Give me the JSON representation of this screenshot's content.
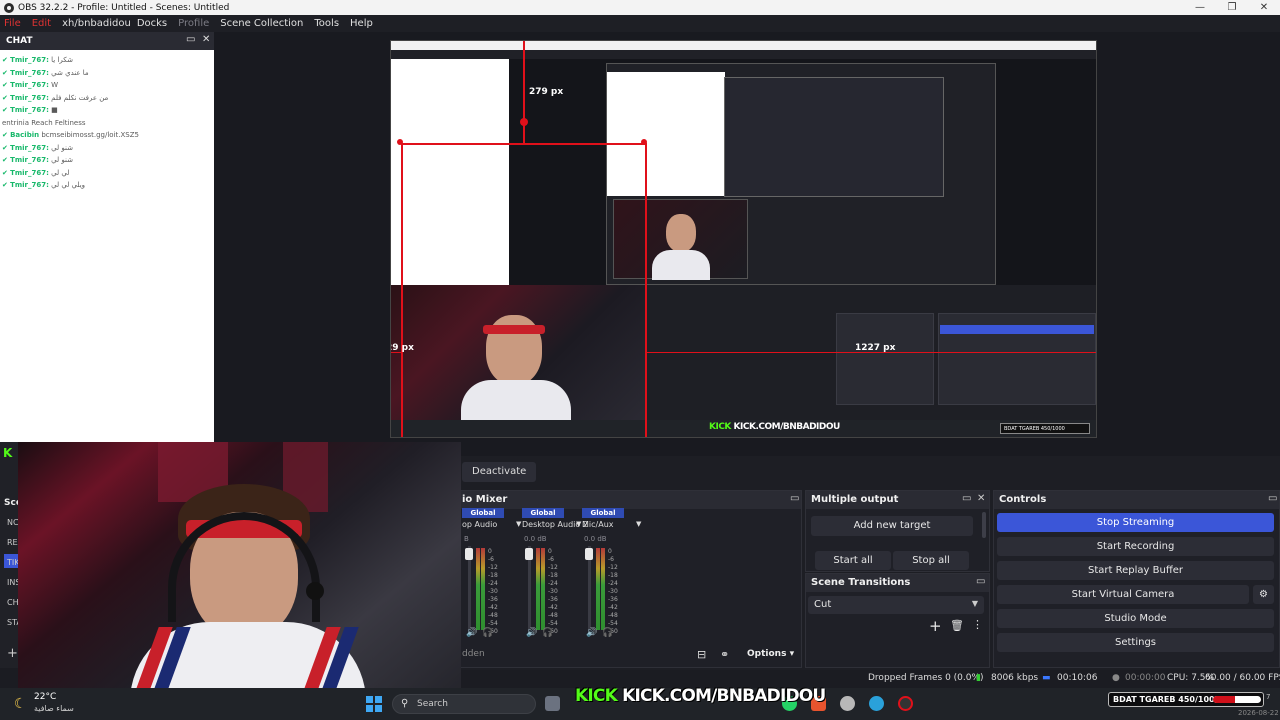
{
  "window": {
    "title": "OBS 32.2.2 - Profile: Untitled - Scenes: Untitled",
    "controls": [
      "—",
      "❐",
      "✕"
    ]
  },
  "menu": [
    "File",
    "Edit",
    "View",
    "Docks",
    "Profile",
    "Scene Collection",
    "Tools",
    "Help"
  ],
  "menu_overlay_text": "xh/bnbadidou",
  "chat": {
    "title": "CHAT",
    "lines": [
      {
        "user": "Tmir_767:",
        "msg": "شكرا يا"
      },
      {
        "user": "Tmir_767:",
        "msg": "ما عندي شي"
      },
      {
        "user": "Tmir_767:",
        "msg": "W"
      },
      {
        "user": "Tmir_767:",
        "msg": "من عرفت نكلم فلم"
      },
      {
        "user": "Tmir_767:",
        "msg": "■"
      },
      {
        "user": "",
        "msg": "entrinia Reach Feltiness"
      },
      {
        "user": "Bacibin",
        "msg": "bcmseibimosst.gg/loit.XSZ5"
      },
      {
        "user": "Tmir_767:",
        "msg": "شنو لي"
      },
      {
        "user": "Tmir_767:",
        "msg": "شنو لي"
      },
      {
        "user": "Tmir_767:",
        "msg": "لي لي"
      },
      {
        "user": "Tmir_767:",
        "msg": "ويلي لي لي"
      }
    ]
  },
  "preview": {
    "measure_top": "279 px",
    "measure_left": "29 px",
    "measure_right": "1227 px",
    "inner_kick": "KICK",
    "inner_kick_url": "KICK.COM/BNBADIDOU",
    "inner_goal": "BDAT TGAREB 450/1000",
    "inner_controls": [
      "Stop Streaming",
      "Start Recording",
      "Start Replay Buffer",
      "Start Virtual Camera",
      "Studio Mode",
      "Settings"
    ],
    "inner_stats": "Dropped Frames 0 (0.0%)   8006 kbps   00:10:06   00:00:00   CPU: 7.5%   60.00 / 60.00 FPS"
  },
  "transition_bar": {
    "filters": "lters",
    "deactivate": "Deactivate"
  },
  "scenes_strip": {
    "head": "Sce",
    "items": [
      "NC",
      "REA",
      "TIK",
      "INS",
      "CH",
      "STA"
    ],
    "add": "+"
  },
  "audio_mixer": {
    "title": "io Mixer",
    "channels": [
      {
        "tag": "Global",
        "name": "op Audio",
        "db": "B"
      },
      {
        "tag": "Global",
        "name": "Desktop Audio 2",
        "db": "0.0 dB"
      },
      {
        "tag": "Global",
        "name": "Mic/Aux",
        "db": "0.0 dB"
      }
    ],
    "scale": [
      "0",
      "-6",
      "-12",
      "-18",
      "-24",
      "-30",
      "-36",
      "-42",
      "-48",
      "-54",
      "-60"
    ],
    "hidden_label": "dden",
    "options": "Options"
  },
  "multiple_output": {
    "title": "Multiple output",
    "add_target": "Add new target",
    "start_all": "Start all",
    "stop_all": "Stop all"
  },
  "scene_transitions": {
    "title": "Scene Transitions",
    "value": "Cut"
  },
  "controls": {
    "title": "Controls",
    "buttons": [
      "Stop Streaming",
      "Start Recording",
      "Start Replay Buffer",
      "Start Virtual Camera",
      "Studio Mode",
      "Settings"
    ]
  },
  "status": {
    "dropped": "Dropped Frames 0 (0.0%)",
    "kbps": "8006 kbps",
    "stream_time": "00:10:06",
    "rec_time": "00:00:00",
    "cpu": "CPU: 7.5%",
    "fps": "60.00 / 60.00 FPS"
  },
  "taskbar": {
    "temp": "22°C",
    "condition": "سماء صافية",
    "search": "Search",
    "kick": "KICK",
    "kick_url": "KICK.COM/BNBADIDOU",
    "goal_text": "BDAT TGAREB 450/1000",
    "goal_progress": 0.45,
    "goal_num": "7",
    "date": "2026-08-22"
  },
  "colors": {
    "accent": "#3b56d8",
    "kick_green": "#53fc18",
    "measure_red": "#e0101a",
    "chat_user": "#17b86a"
  }
}
